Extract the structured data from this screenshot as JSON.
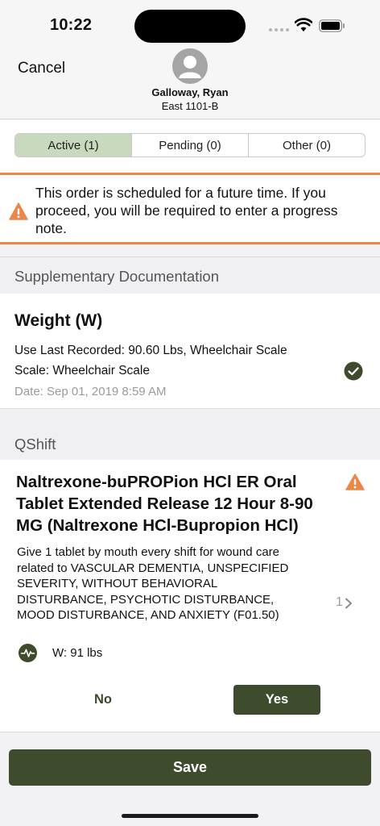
{
  "status_bar": {
    "time": "10:22"
  },
  "header": {
    "cancel_label": "Cancel",
    "patient_name": "Galloway, Ryan",
    "patient_room": "East 1101-B"
  },
  "tabs": [
    {
      "label": "Active (1)",
      "selected": true
    },
    {
      "label": "Pending (0)",
      "selected": false
    },
    {
      "label": "Other (0)",
      "selected": false
    }
  ],
  "warning": {
    "text": "This order is scheduled for a future time. If you proceed, you will be required to enter a progress note."
  },
  "supplementary": {
    "heading": "Supplementary Documentation",
    "title": "Weight (W)",
    "line1": "Use Last Recorded: 90.60 Lbs, Wheelchair Scale",
    "line2": "Scale: Wheelchair Scale",
    "date": "Date: Sep 01, 2019 8:59 AM"
  },
  "qshift": {
    "heading": "QShift",
    "order_title": "Naltrexone-buPROPion HCl ER Oral Tablet Extended Release 12 Hour 8-90 MG (Naltrexone HCl-Bupropion HCl)",
    "order_desc": "Give 1 tablet by mouth every shift for wound care related to VASCULAR DEMENTIA, UNSPECIFIED SEVERITY, WITHOUT BEHAVIORAL DISTURBANCE, PSYCHOTIC DISTURBANCE, MOOD DISTURBANCE, AND ANXIETY (F01.50)",
    "count": "1",
    "vitals": "W: 91 lbs",
    "no_label": "No",
    "yes_label": "Yes"
  },
  "footer": {
    "save_label": "Save"
  },
  "colors": {
    "accent_dark_green": "#3e4b2c",
    "active_tab": "#c8d9bd",
    "warning_orange": "#e8884b"
  }
}
